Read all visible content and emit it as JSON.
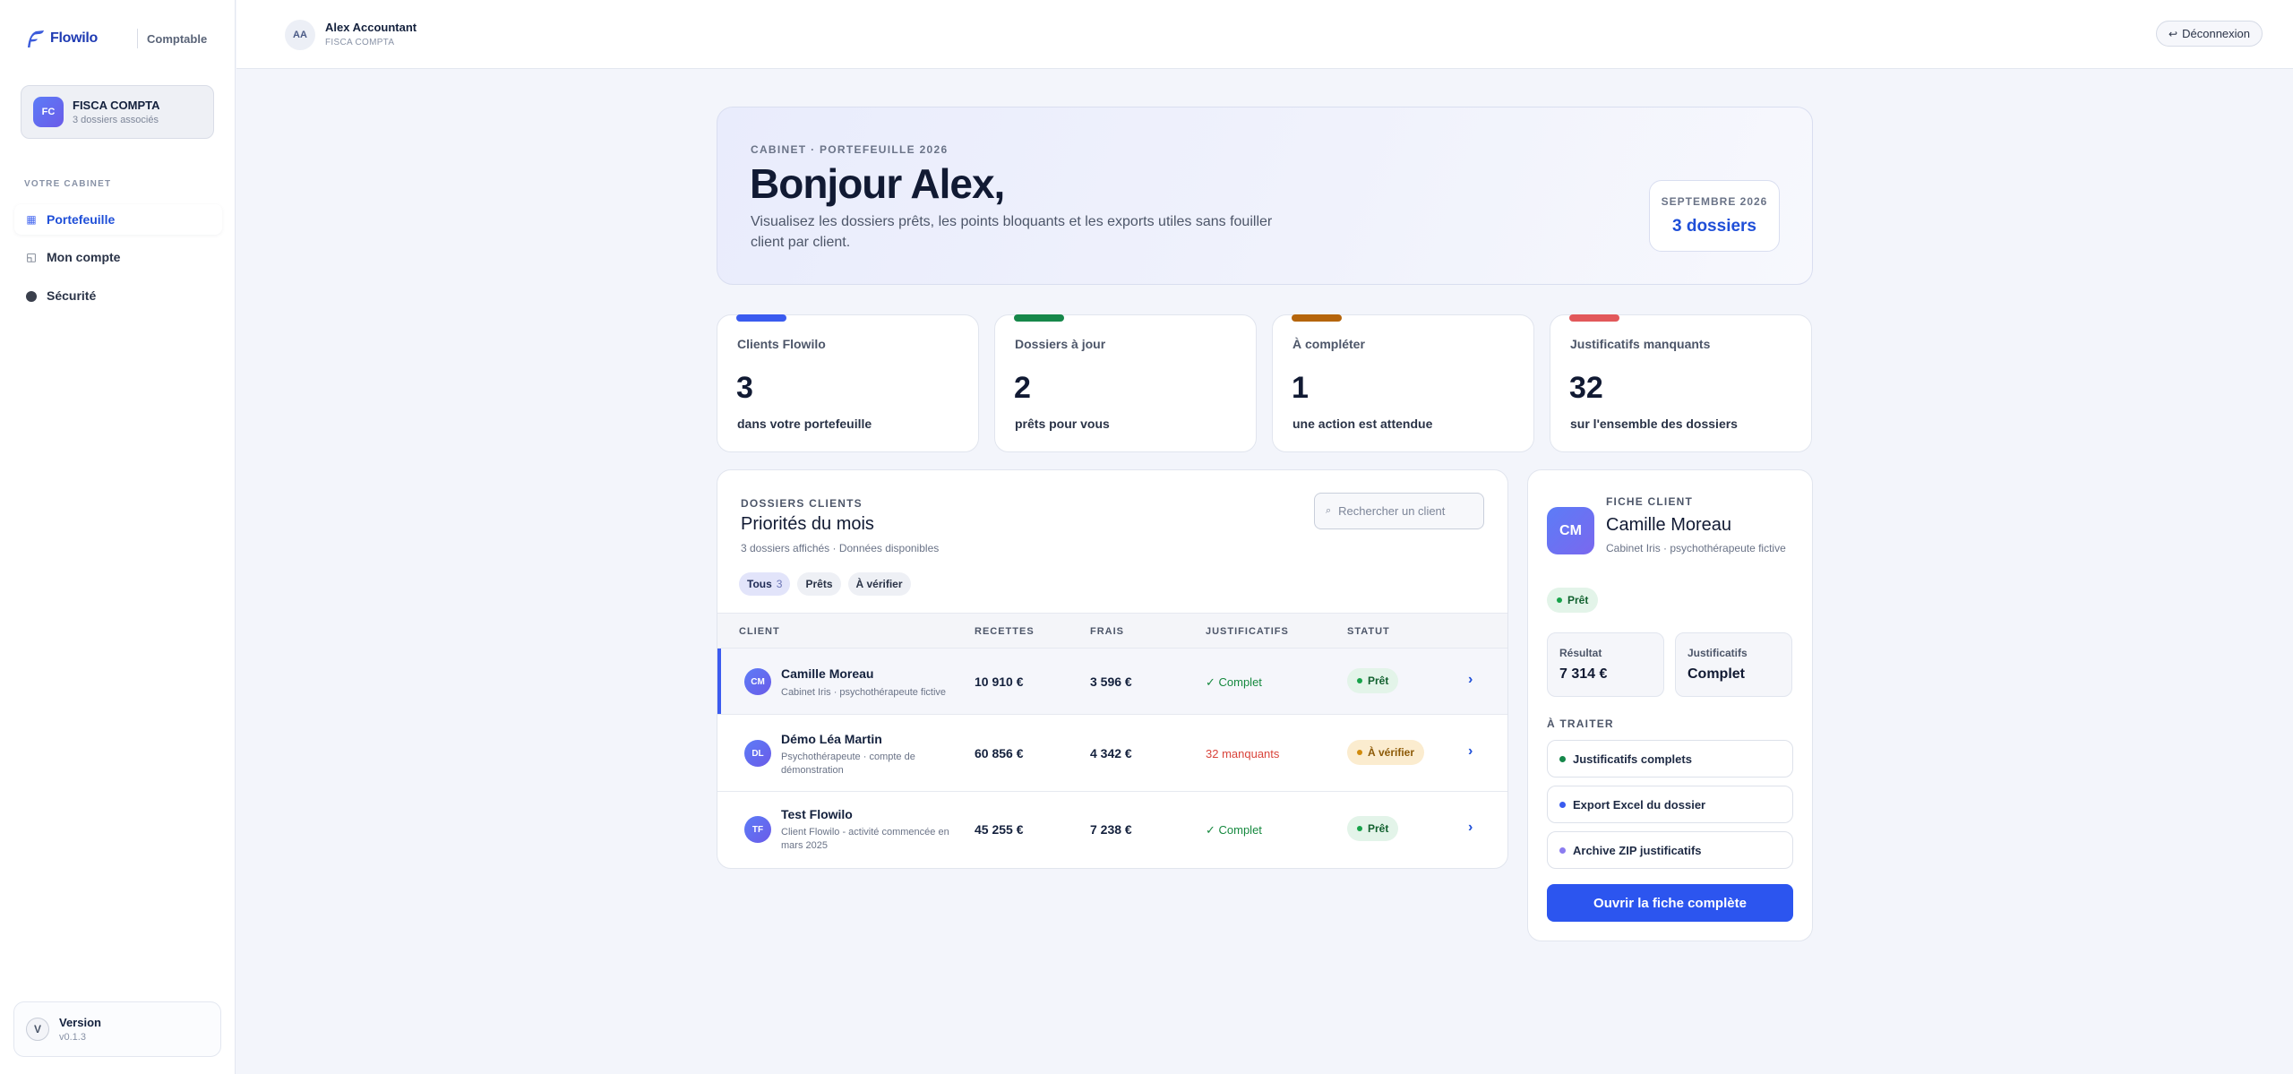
{
  "brand": {
    "name": "Flowilo",
    "role": "Comptable"
  },
  "org": {
    "initials": "FC",
    "name": "FISCA COMPTA",
    "subtitle": "3 dossiers associés"
  },
  "nav": {
    "section": "VOTRE CABINET",
    "items": [
      {
        "label": "Portefeuille",
        "icon": "grid-icon",
        "active": true
      },
      {
        "label": "Mon compte",
        "icon": "account-icon",
        "active": false
      },
      {
        "label": "Sécurité",
        "icon": "security-dot-icon",
        "active": false
      }
    ]
  },
  "version": {
    "badge": "V",
    "title": "Version",
    "number": "v0.1.3"
  },
  "header": {
    "user_initials": "AA",
    "user_name": "Alex Accountant",
    "user_org": "FISCA COMPTA",
    "logout_icon": "↩",
    "logout_label": "Déconnexion"
  },
  "hero": {
    "eyebrow": "CABINET · PORTEFEUILLE 2026",
    "title": "Bonjour Alex,",
    "subtitle": "Visualisez les dossiers prêts, les points bloquants et les exports utiles sans fouiller client par client.",
    "month": "SEPTEMBRE 2026",
    "count": "3 dossiers"
  },
  "kpis": [
    {
      "label": "Clients Flowilo",
      "value": "3",
      "sub": "dans votre portefeuille",
      "color": "#3a5bef"
    },
    {
      "label": "Dossiers à jour",
      "value": "2",
      "sub": "prêts pour vous",
      "color": "#16874a"
    },
    {
      "label": "À compléter",
      "value": "1",
      "sub": "une action est attendue",
      "color": "#b5650c"
    },
    {
      "label": "Justificatifs manquants",
      "value": "32",
      "sub": "sur l'ensemble des dossiers",
      "color": "#e2585a"
    }
  ],
  "clients": {
    "eyebrow": "DOSSIERS CLIENTS",
    "title": "Priorités du mois",
    "subtitle": "3 dossiers affichés · Données disponibles",
    "search_placeholder": "Rechercher un client",
    "search_icon": "⌕",
    "filters": [
      {
        "label": "Tous",
        "count": "3",
        "active": true
      },
      {
        "label": "Prêts",
        "count": "",
        "active": false
      },
      {
        "label": "À vérifier",
        "count": "",
        "active": false
      }
    ],
    "columns": [
      "CLIENT",
      "RECETTES",
      "FRAIS",
      "JUSTIFICATIFS",
      "STATUT"
    ],
    "rows": [
      {
        "initials": "CM",
        "name": "Camille Moreau",
        "desc": "Cabinet Iris · psychothérapeute fictive",
        "recettes": "10 910 €",
        "frais": "3 596 €",
        "justificatifs": "✓ Complet",
        "just_ok": true,
        "statut": "Prêt",
        "statut_ok": true,
        "selected": true
      },
      {
        "initials": "DL",
        "name": "Démo Léa Martin",
        "desc": "Psychothérapeute · compte de démonstration",
        "recettes": "60 856 €",
        "frais": "4 342 €",
        "justificatifs": "32 manquants",
        "just_ok": false,
        "statut": "À vérifier",
        "statut_ok": false,
        "selected": false
      },
      {
        "initials": "TF",
        "name": "Test Flowilo",
        "desc": "Client Flowilo - activité commencée en mars 2025",
        "recettes": "45 255 €",
        "frais": "7 238 €",
        "justificatifs": "✓ Complet",
        "just_ok": true,
        "statut": "Prêt",
        "statut_ok": true,
        "selected": false
      }
    ],
    "chevron": "›"
  },
  "detail": {
    "initials": "CM",
    "eyebrow": "FICHE CLIENT",
    "name": "Camille Moreau",
    "desc": "Cabinet Iris · psychothérapeute fictive",
    "status": "Prêt",
    "result_label": "Résultat",
    "result_value": "7 314 €",
    "just_label": "Justificatifs",
    "just_value": "Complet",
    "section": "À TRAITER",
    "tasks": [
      {
        "label": "Justificatifs complets",
        "color": "#16874a"
      },
      {
        "label": "Export Excel du dossier",
        "color": "#3a5bef"
      },
      {
        "label": "Archive ZIP justificatifs",
        "color": "#8b7cf0"
      }
    ],
    "open_label": "Ouvrir la fiche complète"
  }
}
